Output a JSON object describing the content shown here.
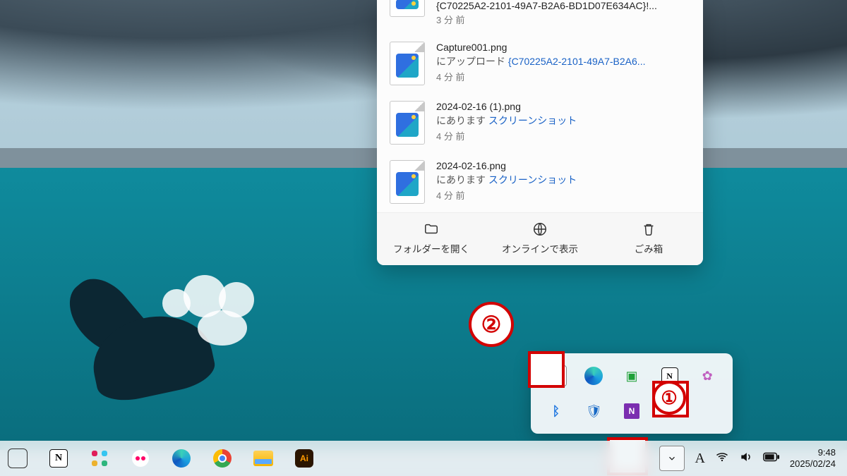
{
  "onedrive": {
    "files": [
      {
        "title": "{C70225A2-2101-49A7-B2A6-BD1D07E634AC}!...",
        "sub_prefix": "",
        "sub_link": "",
        "time": "3 分 前"
      },
      {
        "title": "Capture001.png",
        "sub_prefix": "にアップロード ",
        "sub_link": "{C70225A2-2101-49A7-B2A6...",
        "time": "4 分 前"
      },
      {
        "title": "2024-02-16 (1).png",
        "sub_prefix": "にあります ",
        "sub_link": "スクリーンショット",
        "time": "4 分 前"
      },
      {
        "title": "2024-02-16.png",
        "sub_prefix": "にあります ",
        "sub_link": "スクリーンショット",
        "time": "4 分 前"
      }
    ],
    "actions": {
      "open_folder": "フォルダーを開く",
      "view_online": "オンラインで表示",
      "recycle": "ごみ箱"
    }
  },
  "overflow_tray": {
    "items": [
      {
        "name": "onedrive",
        "glyph": "☁"
      },
      {
        "name": "edge",
        "glyph": ""
      },
      {
        "name": "app-green",
        "glyph": "◆"
      },
      {
        "name": "notion",
        "glyph": "N"
      },
      {
        "name": "teams",
        "glyph": "✿"
      },
      {
        "name": "bluetooth",
        "glyph": "ᛒ"
      },
      {
        "name": "security",
        "glyph": "🛡"
      },
      {
        "name": "onenote",
        "glyph": "N"
      }
    ]
  },
  "taskbar": {
    "apps": [
      "widget",
      "notion",
      "slack",
      "asana",
      "edge",
      "chrome",
      "explorer",
      "illustrator"
    ]
  },
  "systray": {
    "ime": "A",
    "clock_time": "9:48",
    "clock_date": "2025/02/24"
  },
  "annotations": {
    "step1": "①",
    "step2": "②"
  }
}
